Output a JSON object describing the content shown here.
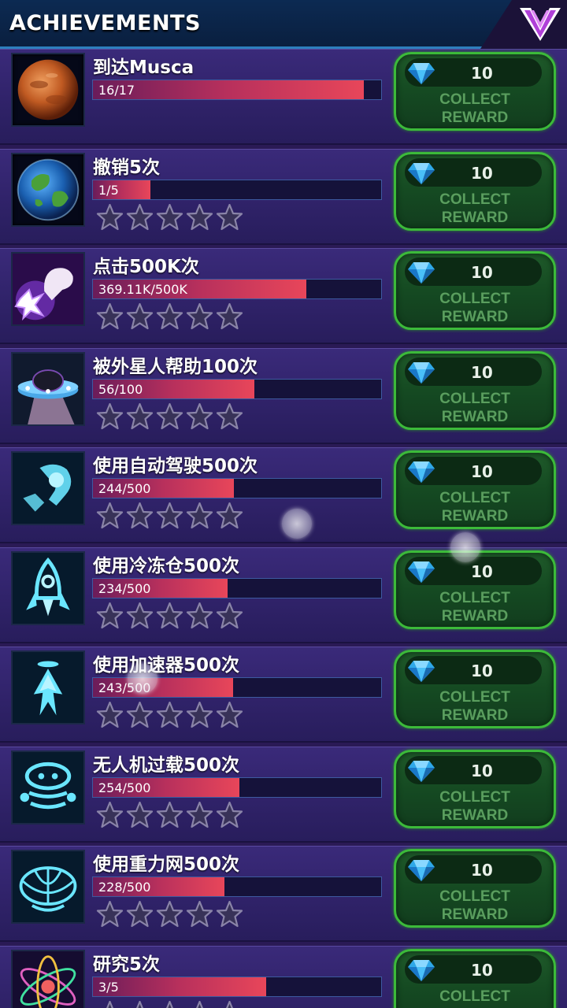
{
  "header": {
    "title": "ACHIEVEMENTS",
    "rank_icon": "chevron-rank-icon"
  },
  "colors": {
    "accent": "#3cba3a",
    "bar_fill": "#e8465a",
    "header_bg": "#0c2a52",
    "row_bg": "#3a2a7a"
  },
  "achievements": [
    {
      "title": "到达Musca",
      "progress_text": "16/17",
      "progress": 0.94,
      "stars": 0,
      "show_stars": false,
      "icon": "mars-planet-icon",
      "reward_amount": "10",
      "collect_label": "COLLECT REWARD"
    },
    {
      "title": "撤销5次",
      "progress_text": "1/5",
      "progress": 0.2,
      "stars": 0,
      "show_stars": true,
      "icon": "earth-planet-icon",
      "reward_amount": "10",
      "collect_label": "COLLECT REWARD"
    },
    {
      "title": "点击500K次",
      "progress_text": "369.11K/500K",
      "progress": 0.74,
      "stars": 0,
      "show_stars": true,
      "icon": "tap-hand-icon",
      "reward_amount": "10",
      "collect_label": "COLLECT REWARD"
    },
    {
      "title": "被外星人帮助100次",
      "progress_text": "56/100",
      "progress": 0.56,
      "stars": 0,
      "show_stars": true,
      "icon": "ufo-icon",
      "reward_amount": "10",
      "collect_label": "COLLECT REWARD"
    },
    {
      "title": "使用自动驾驶500次",
      "progress_text": "244/500",
      "progress": 0.488,
      "stars": 0,
      "show_stars": true,
      "icon": "autopilot-icon",
      "reward_amount": "10",
      "collect_label": "COLLECT REWARD"
    },
    {
      "title": "使用冷冻仓500次",
      "progress_text": "234/500",
      "progress": 0.468,
      "stars": 0,
      "show_stars": true,
      "icon": "cryo-rocket-icon",
      "reward_amount": "10",
      "collect_label": "COLLECT REWARD"
    },
    {
      "title": "使用加速器500次",
      "progress_text": "243/500",
      "progress": 0.486,
      "stars": 0,
      "show_stars": true,
      "icon": "booster-icon",
      "reward_amount": "10",
      "collect_label": "COLLECT REWARD"
    },
    {
      "title": "无人机过载500次",
      "progress_text": "254/500",
      "progress": 0.508,
      "stars": 0,
      "show_stars": true,
      "icon": "drone-robot-icon",
      "reward_amount": "10",
      "collect_label": "COLLECT REWARD"
    },
    {
      "title": "使用重力网500次",
      "progress_text": "228/500",
      "progress": 0.456,
      "stars": 0,
      "show_stars": true,
      "icon": "gravity-net-icon",
      "reward_amount": "10",
      "collect_label": "COLLECT REWARD"
    },
    {
      "title": "研究5次",
      "progress_text": "3/5",
      "progress": 0.6,
      "stars": 0,
      "show_stars": true,
      "icon": "atom-research-icon",
      "reward_amount": "10",
      "collect_label": "COLLECT REWARD"
    }
  ]
}
